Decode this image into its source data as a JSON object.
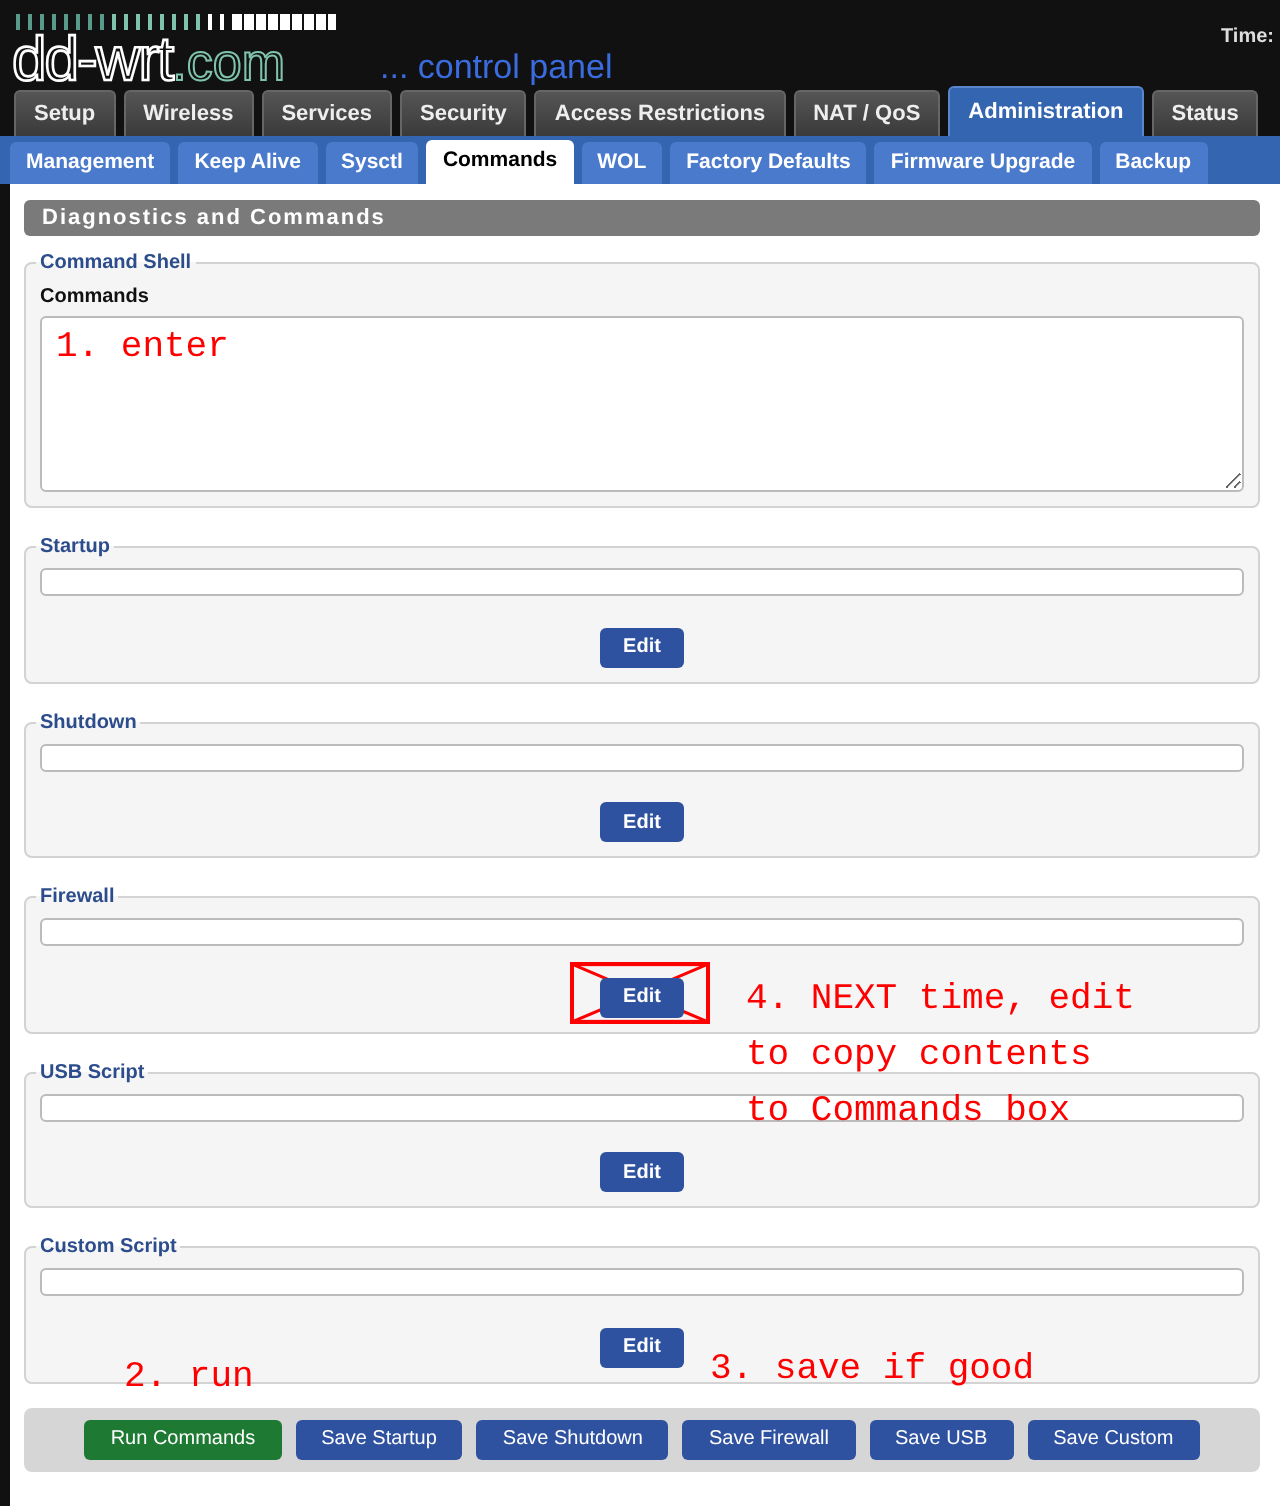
{
  "header": {
    "logo_main": "dd-wrt",
    "logo_domain": ".com",
    "tagline": "... control panel",
    "time_label": "Time:"
  },
  "tabs": [
    {
      "label": "Setup",
      "selected": false
    },
    {
      "label": "Wireless",
      "selected": false
    },
    {
      "label": "Services",
      "selected": false
    },
    {
      "label": "Security",
      "selected": false
    },
    {
      "label": "Access Restrictions",
      "selected": false
    },
    {
      "label": "NAT / QoS",
      "selected": false
    },
    {
      "label": "Administration",
      "selected": true
    },
    {
      "label": "Status",
      "selected": false
    }
  ],
  "subtabs": [
    {
      "label": "Management",
      "selected": false
    },
    {
      "label": "Keep Alive",
      "selected": false
    },
    {
      "label": "Sysctl",
      "selected": false
    },
    {
      "label": "Commands",
      "selected": true
    },
    {
      "label": "WOL",
      "selected": false
    },
    {
      "label": "Factory Defaults",
      "selected": false
    },
    {
      "label": "Firmware Upgrade",
      "selected": false
    },
    {
      "label": "Backup",
      "selected": false
    }
  ],
  "section_title": "Diagnostics and Commands",
  "command_shell": {
    "legend": "Command Shell",
    "label": "Commands",
    "annotation": "1. enter"
  },
  "scripts": [
    {
      "legend": "Startup",
      "button": "Edit",
      "crossed_out": false
    },
    {
      "legend": "Shutdown",
      "button": "Edit",
      "crossed_out": false
    },
    {
      "legend": "Firewall",
      "button": "Edit",
      "crossed_out": true,
      "annotation": [
        "4. NEXT time, edit",
        "to copy contents",
        "to Commands box"
      ]
    },
    {
      "legend": "USB Script",
      "button": "Edit",
      "crossed_out": false
    },
    {
      "legend": "Custom Script",
      "button": "Edit",
      "crossed_out": false
    }
  ],
  "actions": {
    "run_annotation": "2. run",
    "save_annotation": "3. save if good",
    "buttons": [
      {
        "label": "Run Commands",
        "kind": "run"
      },
      {
        "label": "Save Startup",
        "kind": "save"
      },
      {
        "label": "Save Shutdown",
        "kind": "save"
      },
      {
        "label": "Save Firewall",
        "kind": "save"
      },
      {
        "label": "Save USB",
        "kind": "save"
      },
      {
        "label": "Save Custom",
        "kind": "save"
      }
    ]
  }
}
